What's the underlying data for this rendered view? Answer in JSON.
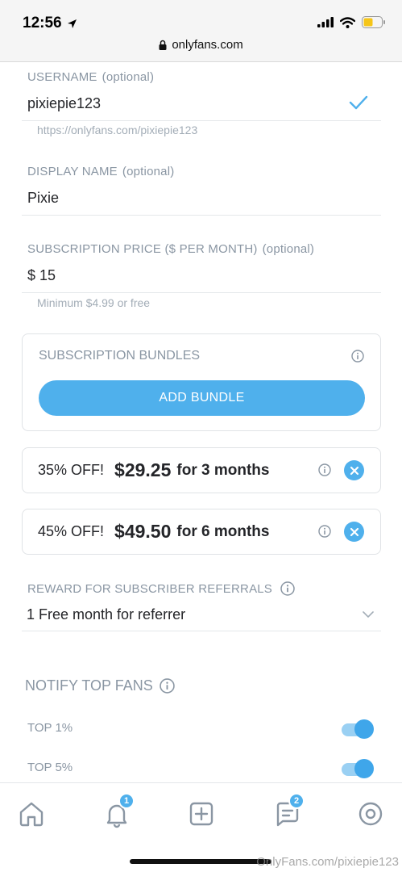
{
  "status_bar": {
    "time": "12:56",
    "url": "onlyfans.com"
  },
  "form": {
    "username": {
      "label": "USERNAME",
      "optional": "(optional)",
      "value": "pixiepie123",
      "helper": "https://onlyfans.com/pixiepie123"
    },
    "display_name": {
      "label": "DISPLAY NAME",
      "optional": "(optional)",
      "value": "Pixie"
    },
    "subscription_price": {
      "label": "SUBSCRIPTION PRICE ($ PER MONTH)",
      "optional": "(optional)",
      "value": "$ 15",
      "helper": "Minimum $4.99 or free"
    }
  },
  "bundles": {
    "title": "SUBSCRIPTION BUNDLES",
    "add_label": "ADD BUNDLE",
    "items": [
      {
        "discount": "35% OFF!",
        "price": "$29.25",
        "duration": "for 3 months"
      },
      {
        "discount": "45% OFF!",
        "price": "$49.50",
        "duration": "for 6 months"
      }
    ]
  },
  "referral": {
    "label": "REWARD FOR SUBSCRIBER REFERRALS",
    "value": "1 Free month for referrer"
  },
  "notify": {
    "title": "NOTIFY TOP FANS",
    "options": [
      {
        "label": "TOP 1%",
        "enabled": true
      },
      {
        "label": "TOP 5%",
        "enabled": true
      }
    ]
  },
  "nav": {
    "notifications_badge": "1",
    "messages_badge": "2"
  },
  "watermark": "OnlyFans.com/pixiepie123",
  "colors": {
    "accent": "#4fb0ec",
    "label": "#8a96a3"
  }
}
